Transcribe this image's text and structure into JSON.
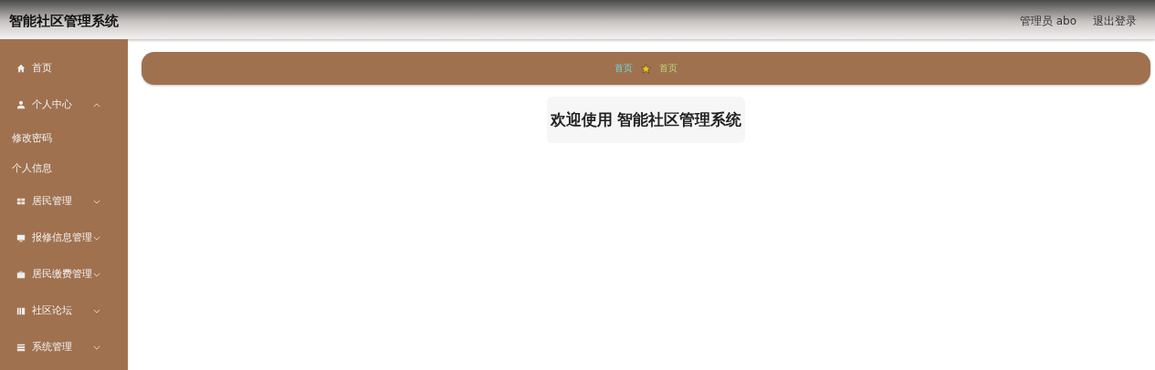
{
  "header": {
    "title": "智能社区管理系统",
    "user": "管理员 abo",
    "logout": "退出登录"
  },
  "sidebar": {
    "items": [
      {
        "label": "首页"
      },
      {
        "label": "个人中心",
        "expanded": true,
        "children": [
          {
            "label": "修改密码"
          },
          {
            "label": "个人信息"
          }
        ]
      },
      {
        "label": "居民管理",
        "expanded": false
      },
      {
        "label": "报修信息管理",
        "expanded": false
      },
      {
        "label": "居民缴费管理",
        "expanded": false
      },
      {
        "label": "社区论坛",
        "expanded": false
      },
      {
        "label": "系统管理",
        "expanded": false
      }
    ]
  },
  "breadcrumb": [
    "首页",
    "首页"
  ],
  "welcome": "欢迎使用 智能社区管理系统"
}
